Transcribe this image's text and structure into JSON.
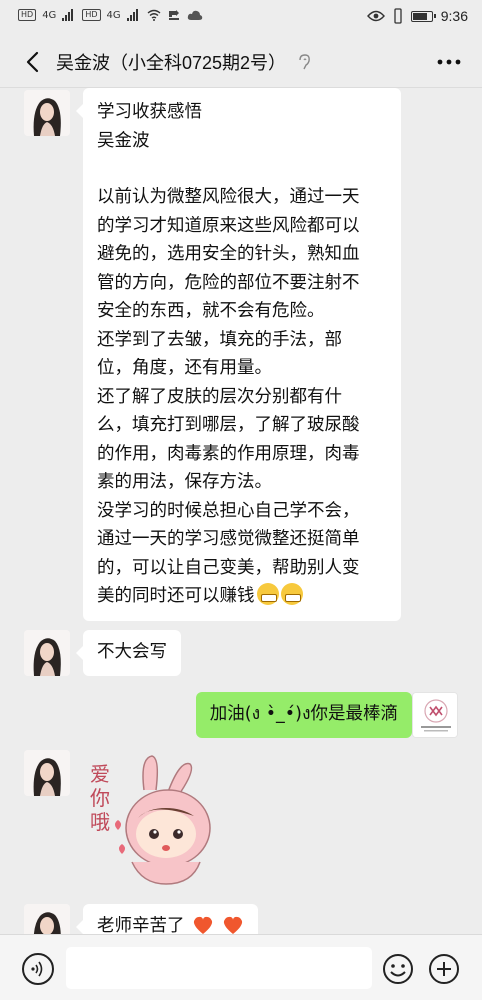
{
  "status_bar": {
    "time": "9:36",
    "net_type_1": "4G",
    "net_type_2": "4G",
    "hd_label": "HD",
    "battery_level": 0.85
  },
  "header": {
    "title": "吴金波（小全科0725期2号）"
  },
  "messages": [
    {
      "side": "left",
      "paragraphs": [
        "学习收获感悟\n吴金波",
        "以前认为微整风险很大，通过一天\n的学习才知道原来这些风险都可以\n避免的，选用安全的针头，熟知血\n管的方向，危险的部位不要注射不\n安全的东西，就不会有危险。\n还学到了去皱，填充的手法，部\n位，角度，还有用量。\n还了解了皮肤的层次分别都有什\n么，填充打到哪层，了解了玻尿酸\n的作用，肉毒素的作用原理，肉毒\n素的用法，保存方法。\n没学习的时候总担心自己学不会，\n通过一天的学习感觉微整还挺简单\n的，可以让自己变美，帮助别人变\n美的同时还可以赚钱"
      ],
      "emoji": [
        "grinning-face",
        "grinning-face"
      ]
    },
    {
      "side": "left",
      "text": "不大会写"
    },
    {
      "side": "right",
      "text": "加油(ง •̀_•́)ง你是最棒滴"
    },
    {
      "side": "left",
      "sticker": {
        "text": "爱\n你\n哦"
      }
    },
    {
      "side": "left",
      "text": "老师辛苦了",
      "emoji": [
        "red-heart",
        "red-heart"
      ]
    }
  ],
  "input": {
    "placeholder": ""
  },
  "colors": {
    "chat_bg": "#ededed",
    "bubble_white": "#ffffff",
    "bubble_green": "#95ec69"
  }
}
